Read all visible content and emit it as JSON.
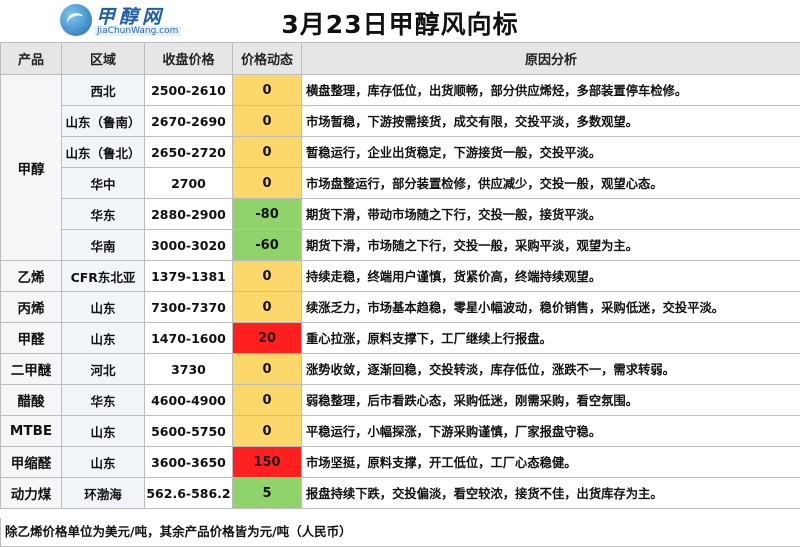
{
  "header": {
    "logo_cn": "甲醇网",
    "logo_en": "JiaChunWang.com",
    "title": "3月23日甲醇风向标"
  },
  "table": {
    "columns": [
      "产品",
      "区域",
      "收盘价格",
      "价格动态",
      "原因分析"
    ],
    "groups": [
      {
        "product": "甲醇",
        "rows": [
          {
            "region": "西北",
            "price": "2500-2610",
            "change": "0",
            "change_color": "#fcd86a",
            "reason": "横盘整理，库存低位，出货顺畅，部分供应烯烃，多部装置停车检修。"
          },
          {
            "region": "山东（鲁南）",
            "price": "2670-2690",
            "change": "0",
            "change_color": "#fcd86a",
            "reason": "市场暂稳，下游按需接货，成交有限，交投平淡，多数观望。"
          },
          {
            "region": "山东（鲁北）",
            "price": "2650-2720",
            "change": "0",
            "change_color": "#fcd86a",
            "reason": "暂稳运行，企业出货稳定，下游接货一般，交投平淡。"
          },
          {
            "region": "华中",
            "price": "2700",
            "change": "0",
            "change_color": "#fcd86a",
            "reason": "市场盘整运行，部分装置检修，供应减少，交投一般，观望心态。"
          },
          {
            "region": "华东",
            "price": "2880-2900",
            "change": "-80",
            "change_color": "#8fd36a",
            "reason": "期货下滑，带动市场随之下行，交投一般，接货平淡。"
          },
          {
            "region": "华南",
            "price": "3000-3020",
            "change": "-60",
            "change_color": "#8fd36a",
            "reason": "期货下滑，市场随之下行，交投一般，采购平淡，观望为主。"
          }
        ]
      },
      {
        "product": "乙烯",
        "rows": [
          {
            "region": "CFR东北亚",
            "price": "1379-1381",
            "change": "0",
            "change_color": "#fcd86a",
            "reason": "持续走稳，终端用户谨慎，货紧价高，终端持续观望。"
          }
        ]
      },
      {
        "product": "丙烯",
        "rows": [
          {
            "region": "山东",
            "price": "7300-7370",
            "change": "0",
            "change_color": "#fcd86a",
            "reason": "续涨乏力，市场基本趋稳，零星小幅波动，稳价销售，采购低迷，交投平淡。"
          }
        ]
      },
      {
        "product": "甲醛",
        "rows": [
          {
            "region": "山东",
            "price": "1470-1600",
            "change": "20",
            "change_color": "#ff1f1f",
            "reason": "重心拉涨，原料支撑下，工厂继续上行报盘。"
          }
        ]
      },
      {
        "product": "二甲醚",
        "rows": [
          {
            "region": "河北",
            "price": "3730",
            "change": "0",
            "change_color": "#fcd86a",
            "reason": "涨势收敛，逐渐回稳，交投转淡，库存低位，涨跌不一，需求转弱。"
          }
        ]
      },
      {
        "product": "醋酸",
        "rows": [
          {
            "region": "华东",
            "price": "4600-4900",
            "change": "0",
            "change_color": "#fcd86a",
            "reason": "弱稳整理，后市看跌心态，采购低迷，刚需采购，看空氛围。"
          }
        ]
      },
      {
        "product": "MTBE",
        "rows": [
          {
            "region": "山东",
            "price": "5600-5750",
            "change": "0",
            "change_color": "#fcd86a",
            "reason": "平稳运行，小幅探涨，下游采购谨慎，厂家报盘守稳。"
          }
        ]
      },
      {
        "product": "甲缩醛",
        "rows": [
          {
            "region": "山东",
            "price": "3600-3650",
            "change": "150",
            "change_color": "#ff1f1f",
            "reason": "市场坚挺，原料支撑，开工低位，工厂心态稳健。"
          }
        ]
      },
      {
        "product": "动力煤",
        "rows": [
          {
            "region": "环渤海",
            "price": "562.6-586.2",
            "change": "5",
            "change_color": "#8fd36a",
            "reason": "报盘持续下跌，交投偏淡，看空较浓，接货不佳，出货库存为主。"
          }
        ]
      }
    ]
  },
  "footnote": "除乙烯价格单位为美元/吨，其余产品价格皆为元/吨（人民币）"
}
